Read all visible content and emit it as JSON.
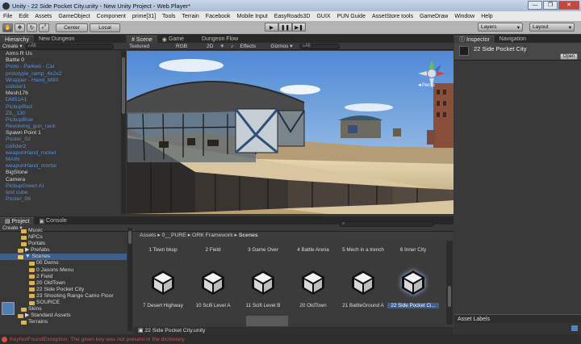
{
  "window": {
    "title": "Unity - 22 Side Pocket City.unity - New Unity Project - Web Player*",
    "buttons": [
      "—",
      "❐",
      "✕"
    ]
  },
  "menu": [
    "File",
    "Edit",
    "Assets",
    "GameObject",
    "Component",
    "prime[31]",
    "Tools",
    "Terrain",
    "Facebook",
    "Mobile Input",
    "EasyRoads3D",
    "GUIX",
    "PUN Guide",
    "AssetStore tools",
    "GameDraw",
    "Window",
    "Help"
  ],
  "toolbar": {
    "pivot": "Center",
    "space": "Local",
    "layers": "Layers",
    "layout": "Layout"
  },
  "hierarchy": {
    "tabs": [
      "Hierarchy",
      "New Dungeon"
    ],
    "create": "Create ▾",
    "search": "All",
    "items": [
      {
        "label": "Arms R Us",
        "blue": false
      },
      {
        "label": "Battle 0",
        "blue": false
      },
      {
        "label": "Proto - Parked - Car",
        "blue": true
      },
      {
        "label": "prototype_ramp_4x2x2",
        "blue": true
      },
      {
        "label": "Wrapper - Hand_M80",
        "blue": true
      },
      {
        "label": "collider1",
        "blue": true
      },
      {
        "label": "Mesh176",
        "blue": false
      },
      {
        "label": "DM51A1",
        "blue": true
      },
      {
        "label": "PickupRed",
        "blue": true
      },
      {
        "label": "ZiL_130",
        "blue": true
      },
      {
        "label": "PickupBlue",
        "blue": true
      },
      {
        "label": "Revolving_gun_rack",
        "blue": true
      },
      {
        "label": "Spawn Point 1",
        "blue": false
      },
      {
        "label": "Poster_02",
        "blue": true
      },
      {
        "label": "collider2",
        "blue": true
      },
      {
        "label": "weaponHand_rocket",
        "blue": true
      },
      {
        "label": "MAIN",
        "blue": true
      },
      {
        "label": "weaponHand_mortar",
        "blue": true
      },
      {
        "label": "BigStone",
        "blue": false
      },
      {
        "label": "Camera",
        "blue": false
      },
      {
        "label": "PickupGreen AI",
        "blue": true
      },
      {
        "label": "test cube",
        "blue": true
      },
      {
        "label": "Poster_06",
        "blue": true
      }
    ]
  },
  "sceneview": {
    "tabs": [
      "Scene",
      "Game",
      "Dungeon Flow"
    ],
    "shading": "Textured",
    "render": "RGB",
    "mode2d": "2D",
    "effects": "Effects",
    "gizmos": "Gizmos ▾",
    "search": "All",
    "persp": "◄Persp"
  },
  "project": {
    "tabs": [
      "Project",
      "Console"
    ],
    "create": "Create ▾",
    "tree": [
      {
        "label": "Music",
        "indent": 26,
        "open": false,
        "sel": false
      },
      {
        "label": "NPCs",
        "indent": 26,
        "open": false,
        "sel": false
      },
      {
        "label": "Portals",
        "indent": 26,
        "open": false,
        "sel": false
      },
      {
        "label": "▶ Prefabs",
        "indent": 22,
        "open": false,
        "sel": false
      },
      {
        "label": "▼ Scenes",
        "indent": 22,
        "open": true,
        "sel": true
      },
      {
        "label": "00 Demo",
        "indent": 36,
        "open": false,
        "sel": false
      },
      {
        "label": "0 Jasons Menu",
        "indent": 36,
        "open": false,
        "sel": false
      },
      {
        "label": "2 Field",
        "indent": 36,
        "open": false,
        "sel": false
      },
      {
        "label": "20 OldTown",
        "indent": 36,
        "open": false,
        "sel": false
      },
      {
        "label": "22 Side Pocket City",
        "indent": 36,
        "open": false,
        "sel": false
      },
      {
        "label": "23 Shooting Range Camo Floor",
        "indent": 36,
        "open": false,
        "sel": false
      },
      {
        "label": "SOURCE",
        "indent": 36,
        "open": false,
        "sel": false
      },
      {
        "label": "Skins",
        "indent": 26,
        "open": false,
        "sel": false
      },
      {
        "label": "▶ Standard Assets",
        "indent": 22,
        "open": false,
        "sel": false
      },
      {
        "label": "Terrains",
        "indent": 26,
        "open": false,
        "sel": false
      }
    ],
    "breadcrumb": [
      "Assets",
      "0__PURE",
      "ORK Framework",
      "Scenes"
    ],
    "row1": [
      "1 Town bkup",
      "2 Field",
      "3 Game Over",
      "4 Battle Arena",
      "5 Mech in a trench",
      "6 Inner City"
    ],
    "row2": [
      "7 Desert Highway",
      "10 Scifi Level A",
      "11 Scifi Level B",
      "20 OldTown",
      "21 BattleGround A",
      "22 Side Pocket Ci..."
    ],
    "selected_file": "22 Side Pocket City.unity"
  },
  "inspector": {
    "tabs": [
      "Inspector",
      "Navigation"
    ],
    "object": "22 Side Pocket City",
    "open": "Open",
    "labels": "Asset Labels"
  },
  "status": {
    "message": "KeyNotFoundException: The given key was not present in the dictionary."
  },
  "colors": {
    "selection": "#3d5f8e",
    "prefab_blue": "#5b8fd8",
    "error": "#d54b4b",
    "panel": "#383838"
  }
}
